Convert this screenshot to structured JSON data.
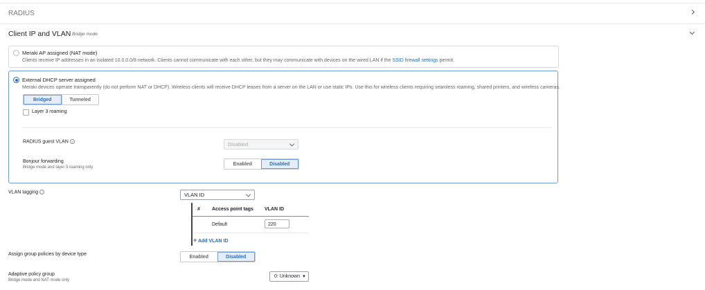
{
  "radius": {
    "title": "RADIUS"
  },
  "client_ip": {
    "title": "Client IP and VLAN",
    "mode_badge": "Bridge mode",
    "nat": {
      "label": "Meraki AP assigned (NAT mode)",
      "desc_prefix": "Clients receive IP addresses in an isolated 10.0.0.0/8 network. Clients cannot communicate with each other, but they may communicate with devices on the wired LAN if the ",
      "desc_link": "SSID firewall settings",
      "desc_suffix": " permit."
    },
    "dhcp": {
      "label": "External DHCP server assigned",
      "desc": "Meraki devices operate transparently (do not perform NAT or DHCP). Wireless clients will receive DHCP leases from a server on the LAN or use static IPs. Use this for wireless clients requiring seamless roaming, shared printers, and wireless cameras.",
      "mode_options": [
        "Bridged",
        "Tunneled"
      ],
      "mode_selected": "Bridged",
      "layer3_label": "Layer 3 roaming",
      "radius_guest_vlan_label": "RADIUS guest VLAN",
      "radius_guest_vlan_value": "Disabled",
      "bonjour_label": "Bonjour forwarding",
      "bonjour_sub": "Bridge mode and layer 3 roaming only",
      "bonjour_options": [
        "Enabled",
        "Disabled"
      ],
      "bonjour_selected": "Disabled"
    }
  },
  "vlan_tagging": {
    "label": "VLAN tagging",
    "select_value": "VLAN ID",
    "table": {
      "headers": [
        "#",
        "Access point tags",
        "VLAN ID"
      ],
      "rows": [
        {
          "num": "",
          "tag": "Default",
          "vlan": "220"
        }
      ]
    },
    "add_label": "Add VLAN ID"
  },
  "group_policies": {
    "label": "Assign group policies by device type",
    "options": [
      "Enabled",
      "Disabled"
    ],
    "selected": "Disabled"
  },
  "adaptive_policy": {
    "label": "Adaptive policy group",
    "sub": "Bridge mode and NAT mode only",
    "value": "0: Unknown"
  }
}
